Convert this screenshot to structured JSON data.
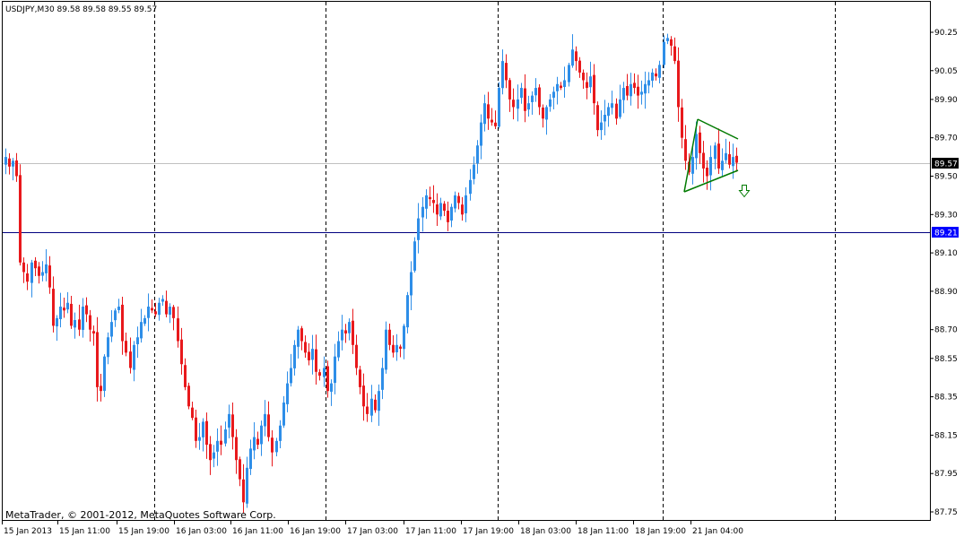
{
  "header": {
    "symbol_line": "USDJPY,M30  89.58 89.58 89.55 89.57"
  },
  "footer": {
    "copyright": "MetaTrader, © 2001-2012, MetaQuotes Software Corp."
  },
  "colors": {
    "up_candle": "#2e8ee8",
    "down_candle": "#e8191c",
    "triangle": "#007a00",
    "arrow": "#007a00",
    "bid_line": "#c0c0c0",
    "level_line": "#000080",
    "level_tag": "#0000ff"
  },
  "chart_data": {
    "type": "candlestick",
    "symbol": "USDJPY",
    "timeframe": "M30",
    "ohlc_last": {
      "open": 89.58,
      "high": 89.58,
      "low": 89.55,
      "close": 89.57
    },
    "ylim": [
      87.7,
      90.3
    ],
    "y_ticks": [
      "90.25",
      "90.05",
      "89.90",
      "89.70",
      "89.50",
      "89.30",
      "89.10",
      "88.90",
      "88.70",
      "88.55",
      "88.35",
      "88.15",
      "87.95",
      "87.75"
    ],
    "x_ticks": [
      "15 Jan 2013",
      "15 Jan 11:00",
      "15 Jan 19:00",
      "16 Jan 03:00",
      "16 Jan 11:00",
      "16 Jan 19:00",
      "17 Jan 03:00",
      "17 Jan 11:00",
      "17 Jan 19:00",
      "18 Jan 03:00",
      "18 Jan 11:00",
      "18 Jan 19:00",
      "21 Jan 04:00"
    ],
    "current_price": "89.57",
    "horizontal_level": "89.21",
    "pattern": "symmetrical-triangle",
    "signal": "down-arrow",
    "closes": [
      89.6,
      89.55,
      89.58,
      89.5,
      89.05,
      89.0,
      88.95,
      89.05,
      89.02,
      88.98,
      89.0,
      89.04,
      88.92,
      88.72,
      88.76,
      88.82,
      88.8,
      88.84,
      88.72,
      88.75,
      88.7,
      88.82,
      88.78,
      88.7,
      88.68,
      88.4,
      88.38,
      88.56,
      88.66,
      88.74,
      88.8,
      88.82,
      88.64,
      88.58,
      88.5,
      88.62,
      88.66,
      88.74,
      88.76,
      88.82,
      88.8,
      88.78,
      88.84,
      88.86,
      88.78,
      88.82,
      88.76,
      88.64,
      88.52,
      88.4,
      88.3,
      88.24,
      88.12,
      88.14,
      88.22,
      88.1,
      88.02,
      88.06,
      88.12,
      88.1,
      88.18,
      88.26,
      88.14,
      88.02,
      87.92,
      87.8,
      87.98,
      88.08,
      88.14,
      88.1,
      88.2,
      88.26,
      88.14,
      88.06,
      88.12,
      88.2,
      88.32,
      88.42,
      88.5,
      88.62,
      88.7,
      88.64,
      88.58,
      88.54,
      88.6,
      88.48,
      88.46,
      88.5,
      88.38,
      88.42,
      88.56,
      88.64,
      88.7,
      88.68,
      88.74,
      88.62,
      88.5,
      88.4,
      88.3,
      88.26,
      88.34,
      88.28,
      88.38,
      88.5,
      88.7,
      88.62,
      88.58,
      88.62,
      88.6,
      88.72,
      88.88,
      89.0,
      89.16,
      89.28,
      89.34,
      89.4,
      89.38,
      89.36,
      89.3,
      89.36,
      89.32,
      89.26,
      89.34,
      89.4,
      89.36,
      89.3,
      89.4,
      89.48,
      89.56,
      89.66,
      89.78,
      89.88,
      89.8,
      89.78,
      89.76,
      89.96,
      90.1,
      90.0,
      89.9,
      89.86,
      89.9,
      89.96,
      89.84,
      89.88,
      89.92,
      89.96,
      89.86,
      89.8,
      89.86,
      89.9,
      89.94,
      89.98,
      89.96,
      90.0,
      90.08,
      90.16,
      90.1,
      90.04,
      90.0,
      89.96,
      90.02,
      89.88,
      89.74,
      89.78,
      89.82,
      89.86,
      89.88,
      89.8,
      89.9,
      89.96,
      89.92,
      89.98,
      89.96,
      89.92,
      89.94,
      89.98,
      90.0,
      90.04,
      90.02,
      90.08,
      90.2,
      90.22,
      90.18,
      90.1,
      89.86,
      89.7,
      89.58,
      89.52,
      89.6,
      89.72,
      89.62,
      89.54,
      89.5,
      89.6,
      89.66,
      89.54,
      89.58,
      89.62,
      89.56,
      89.6,
      89.57
    ]
  }
}
